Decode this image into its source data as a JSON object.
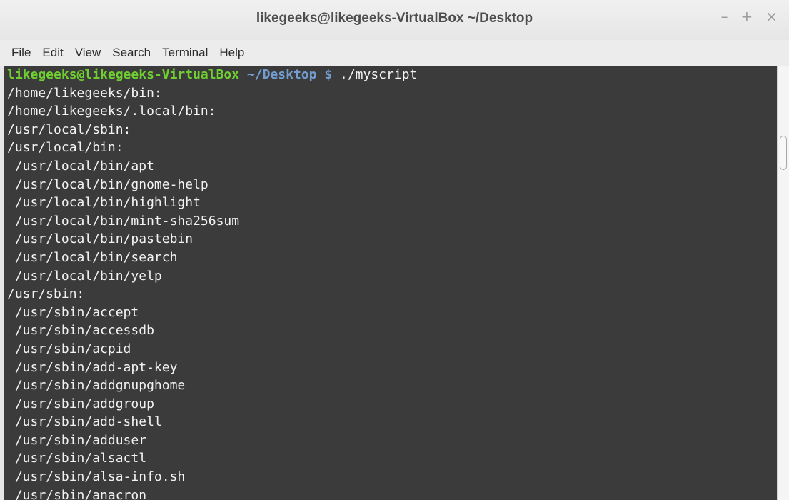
{
  "window": {
    "title": "likegeeks@likegeeks-VirtualBox ~/Desktop",
    "controls": {
      "minimize": "–",
      "maximize": "+",
      "close": "×"
    }
  },
  "menubar": {
    "items": [
      {
        "label": "File"
      },
      {
        "label": "Edit"
      },
      {
        "label": "View"
      },
      {
        "label": "Search"
      },
      {
        "label": "Terminal"
      },
      {
        "label": "Help"
      }
    ]
  },
  "terminal": {
    "prompt": {
      "user_host": "likegeeks@likegeeks-VirtualBox",
      "path": " ~/Desktop $",
      "command": " ./myscript"
    },
    "output": [
      "/home/likegeeks/bin:",
      "/home/likegeeks/.local/bin:",
      "/usr/local/sbin:",
      "/usr/local/bin:",
      " /usr/local/bin/apt",
      " /usr/local/bin/gnome-help",
      " /usr/local/bin/highlight",
      " /usr/local/bin/mint-sha256sum",
      " /usr/local/bin/pastebin",
      " /usr/local/bin/search",
      " /usr/local/bin/yelp",
      "/usr/sbin:",
      " /usr/sbin/accept",
      " /usr/sbin/accessdb",
      " /usr/sbin/acpid",
      " /usr/sbin/add-apt-key",
      " /usr/sbin/addgnupghome",
      " /usr/sbin/addgroup",
      " /usr/sbin/add-shell",
      " /usr/sbin/adduser",
      " /usr/sbin/alsactl",
      " /usr/sbin/alsa-info.sh",
      " /usr/sbin/anacron"
    ]
  },
  "colors": {
    "terminal_bg": "#3b3b3b",
    "prompt_user": "#6fcf30",
    "prompt_path": "#729fcf",
    "text": "#f2f2f2"
  }
}
